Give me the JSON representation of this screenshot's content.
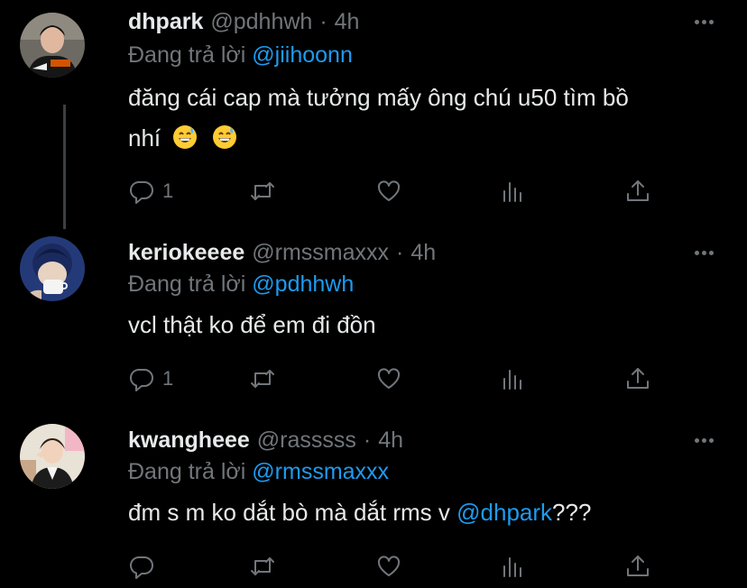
{
  "tweets": [
    {
      "name": "dhpark",
      "handle": "@pdhhwh",
      "sep": "·",
      "time": "4h",
      "reply_prefix": "Đang trả lời",
      "reply_to": "@jiihoonn",
      "text_line1": "đăng cái cap mà tưởng mấy ông chú u50 tìm bồ",
      "text_line2": "nhí",
      "emoji": [
        "grinning-face-with-sweat",
        "grinning-face-with-sweat"
      ],
      "reply_count": "1"
    },
    {
      "name": "keriokeeee",
      "handle": "@rmssmaxxx",
      "sep": "·",
      "time": "4h",
      "reply_prefix": "Đang trả lời",
      "reply_to": "@pdhhwh",
      "text": "vcl thật ko để em đi đồn",
      "reply_count": "1"
    },
    {
      "name": "kwangheee",
      "handle": "@rasssss",
      "sep": "·",
      "time": "4h",
      "reply_prefix": "Đang trả lời",
      "reply_to": "@rmssmaxxx",
      "text_before": "đm s m ko dắt bò mà dắt rms v ",
      "text_mention": "@dhpark",
      "text_after": "???",
      "reply_count": ""
    }
  ],
  "colors": {
    "background": "#000000",
    "text": "#e7e9ea",
    "muted": "#71767b",
    "accent": "#1d9bf0"
  },
  "icons": [
    "reply-icon",
    "retweet-icon",
    "like-icon",
    "views-icon",
    "share-icon",
    "more-icon"
  ]
}
